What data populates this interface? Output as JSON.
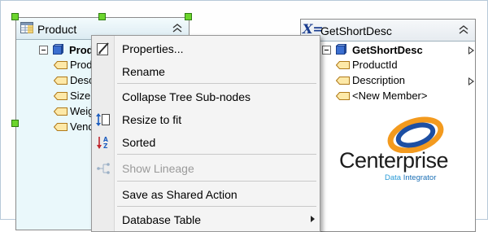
{
  "product_node": {
    "title": "Product",
    "root_label": "Prod",
    "fields": [
      "Prod",
      "Desc",
      "Size",
      "Weig",
      "Vend"
    ]
  },
  "gsd_node": {
    "title_prefix": "X=",
    "title": "GetShortDesc",
    "root_label": "GetShortDesc",
    "fields": [
      "ProductId",
      "Description",
      "<New Member>"
    ]
  },
  "logo": {
    "word": "Centerprise",
    "sub_a": "Data",
    "sub_b": "Integrator",
    "colors": {
      "swoosh_orange": "#f39a1e",
      "swoosh_blue": "#1d4fa3",
      "sub": "#2a9bd7"
    }
  },
  "context_menu": {
    "items": [
      {
        "label": "Properties...",
        "icon": "properties-icon",
        "enabled": true
      },
      {
        "label": "Rename",
        "icon": "",
        "enabled": true
      },
      {
        "label": "Collapse Tree Sub-nodes",
        "icon": "",
        "enabled": true
      },
      {
        "label": "Resize to fit",
        "icon": "resize-icon",
        "enabled": true
      },
      {
        "label": "Sorted",
        "icon": "sort-az-icon",
        "enabled": true
      },
      {
        "label": "Show Lineage",
        "icon": "lineage-icon",
        "enabled": false
      },
      {
        "label": "Save as Shared Action",
        "icon": "",
        "enabled": true
      },
      {
        "label": "Database Table",
        "icon": "",
        "enabled": true,
        "submenu": true
      }
    ]
  },
  "colors": {
    "selection_handle": "#6cd52d",
    "product_body": "#eaf8fb"
  }
}
